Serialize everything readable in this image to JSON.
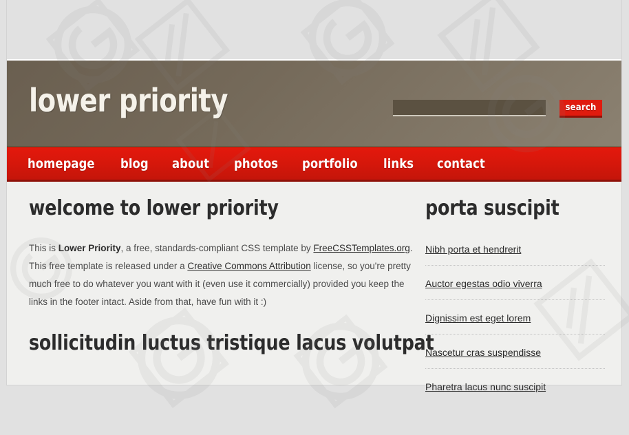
{
  "site": {
    "title": "lower priority"
  },
  "search": {
    "value": "",
    "placeholder": "",
    "button_label": "search"
  },
  "nav": {
    "items": [
      {
        "label": "homepage"
      },
      {
        "label": "blog"
      },
      {
        "label": "about"
      },
      {
        "label": "photos"
      },
      {
        "label": "portfolio"
      },
      {
        "label": "links"
      },
      {
        "label": "contact"
      }
    ]
  },
  "main": {
    "heading": "welcome to lower priority",
    "paragraph": {
      "p1": "This is ",
      "strong1": "Lower Priority",
      "p2": ", a free, standards-compliant CSS template by ",
      "link1": "FreeCSSTemplates.org",
      "p3": ". This free template is released under a ",
      "link2": "Creative Commons Attribution",
      "p4": " license, so you're pretty much free to do whatever you want with it (even use it commercially) provided you keep the links in the footer intact. Aside from that, have fun with it :)"
    },
    "heading2": "sollicitudin luctus tristique lacus volutpat"
  },
  "sidebar": {
    "heading": "porta suscipit",
    "items": [
      {
        "label": "Nibh porta et hendrerit"
      },
      {
        "label": "Auctor egestas odio viverra"
      },
      {
        "label": "Dignissim est eget lorem"
      },
      {
        "label": "Nascetur cras suspendisse"
      },
      {
        "label": "Pharetra lacus nunc suscipit"
      }
    ]
  },
  "colors": {
    "accent_red": "#d4170b",
    "header_brown": "#756a5a",
    "page_background": "#f0f0ee",
    "outer_background": "#e1e1e1"
  }
}
